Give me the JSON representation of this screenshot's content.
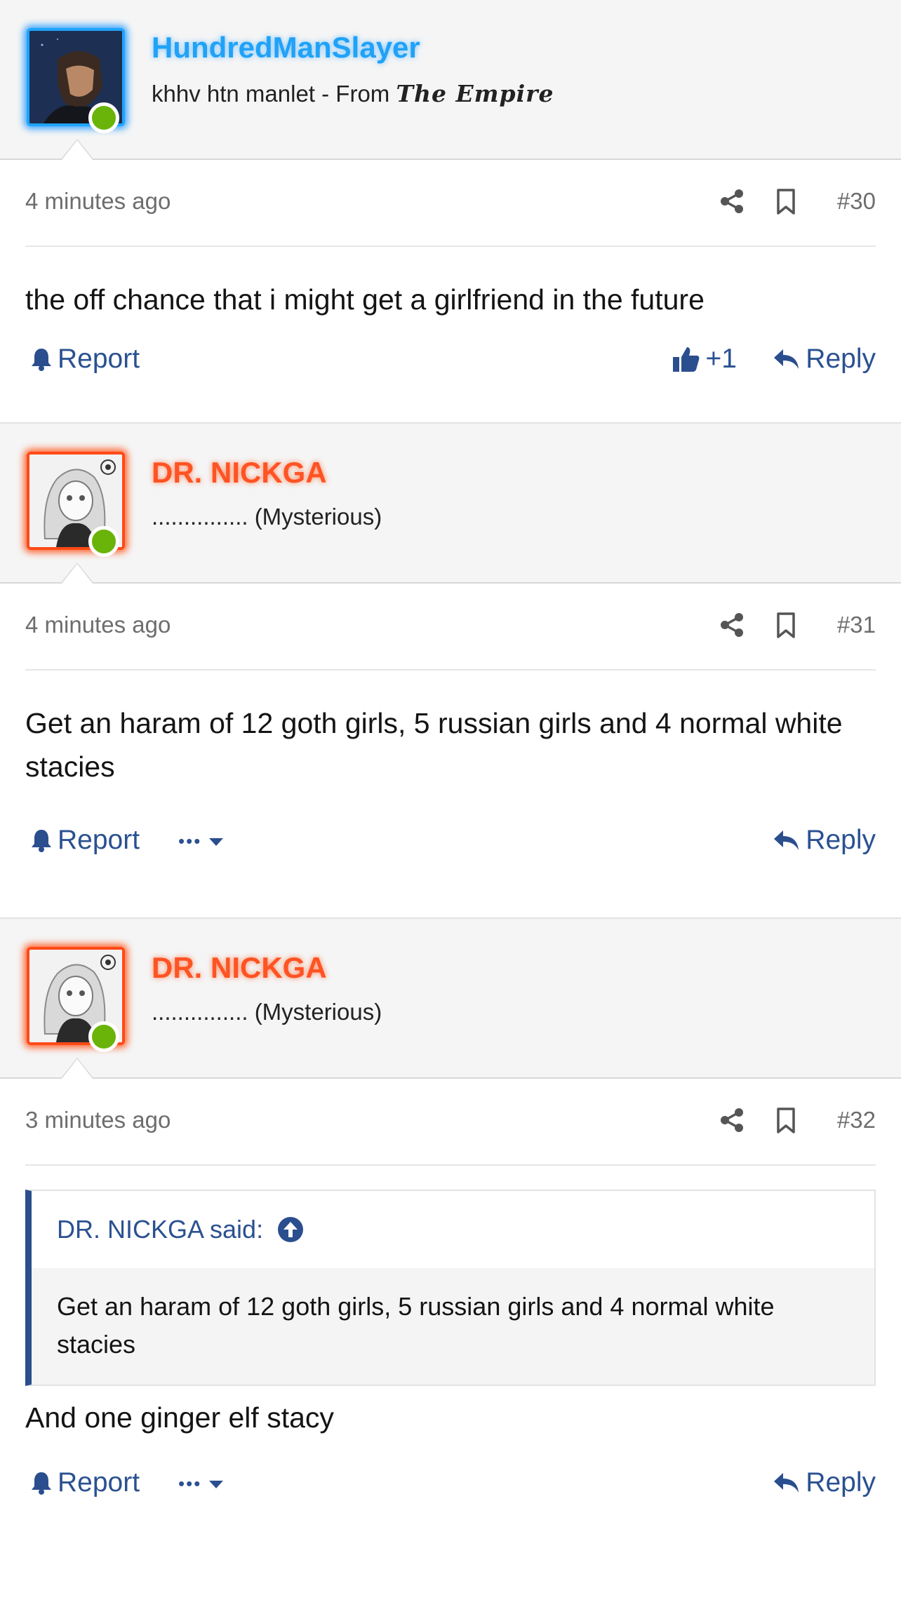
{
  "posts": [
    {
      "username": "HundredManSlayer",
      "usertitle_prefix": "khhv htn manlet - From ",
      "usertitle_emphasis": "The Empire",
      "time": "4 minutes ago",
      "number": "#30",
      "message": "the off chance that i might get a girlfriend in the future",
      "report_label": "Report",
      "like_count": "+1",
      "reply_label": "Reply"
    },
    {
      "username": "DR. NICKGA",
      "usertitle": "............... (Mysterious)",
      "time": "4 minutes ago",
      "number": "#31",
      "message": "Get an haram of 12 goth girls, 5 russian girls and 4 normal white stacies",
      "report_label": "Report",
      "more_label": "•••",
      "reply_label": "Reply"
    },
    {
      "username": "DR. NICKGA",
      "usertitle": "............... (Mysterious)",
      "time": "3 minutes ago",
      "number": "#32",
      "quote_author": "DR. NICKGA said:",
      "quote_text": "Get an haram of 12 goth girls, 5 russian girls and 4 normal white stacies",
      "message": "And one ginger elf stacy",
      "report_label": "Report",
      "more_label": "•••",
      "reply_label": "Reply"
    }
  ],
  "colors": {
    "link": "#2a5191",
    "online": "#6ab40a",
    "blue_name": "#20a2f7",
    "orange_name": "#ff5323",
    "quote_bar": "#2a4e8e"
  }
}
